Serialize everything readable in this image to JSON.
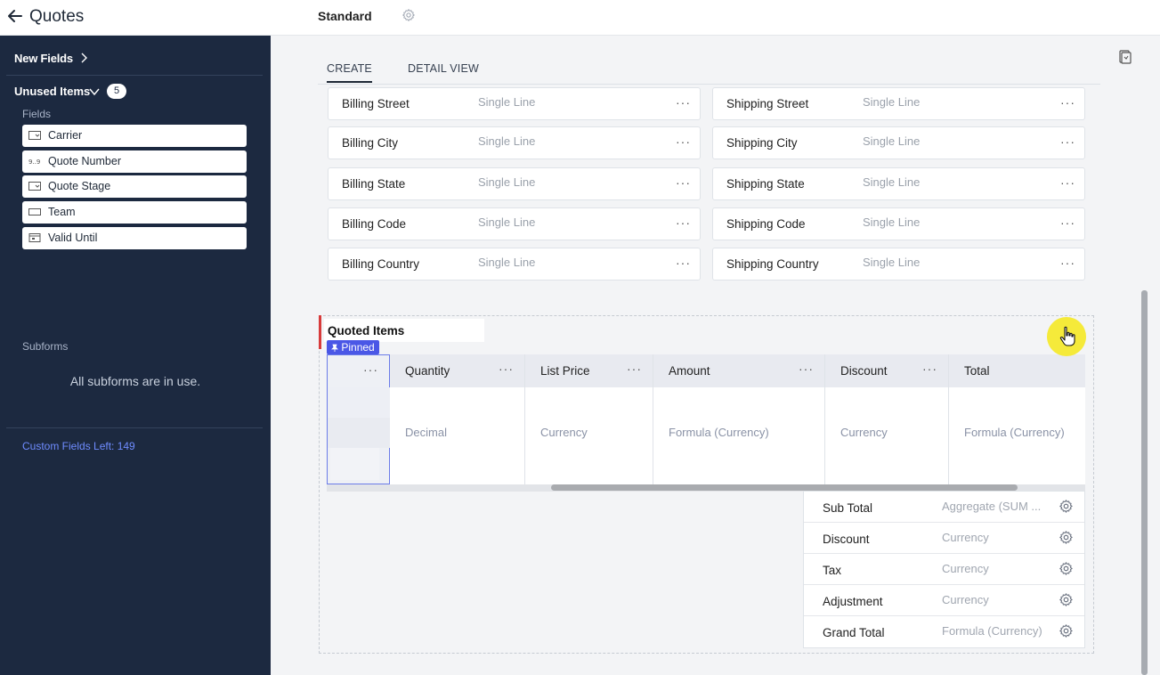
{
  "header": {
    "title": "Quotes",
    "layout_name": "Standard"
  },
  "sidebar": {
    "new_fields_label": "New Fields",
    "unused_items_label": "Unused Items",
    "unused_count": "5",
    "fields_section": "Fields",
    "fields": [
      {
        "label": "Carrier",
        "icon": "picklist-icon"
      },
      {
        "label": "Quote Number",
        "icon": "auto-number-icon"
      },
      {
        "label": "Quote Stage",
        "icon": "picklist-icon"
      },
      {
        "label": "Team",
        "icon": "single-line-icon"
      },
      {
        "label": "Valid Until",
        "icon": "calendar-icon"
      }
    ],
    "subforms_section": "Subforms",
    "subforms_message": "All subforms are in use.",
    "custom_fields_left": "Custom Fields Left: 149"
  },
  "tabs": [
    {
      "label": "CREATE",
      "active": true
    },
    {
      "label": "DETAIL VIEW",
      "active": false
    }
  ],
  "address_fields": [
    {
      "left": {
        "name": "Billing Street",
        "type": "Single Line"
      },
      "right": {
        "name": "Shipping Street",
        "type": "Single Line"
      }
    },
    {
      "left": {
        "name": "Billing City",
        "type": "Single Line"
      },
      "right": {
        "name": "Shipping City",
        "type": "Single Line"
      }
    },
    {
      "left": {
        "name": "Billing State",
        "type": "Single Line"
      },
      "right": {
        "name": "Shipping State",
        "type": "Single Line"
      }
    },
    {
      "left": {
        "name": "Billing Code",
        "type": "Single Line"
      },
      "right": {
        "name": "Shipping Code",
        "type": "Single Line"
      }
    },
    {
      "left": {
        "name": "Billing Country",
        "type": "Single Line"
      },
      "right": {
        "name": "Shipping Country",
        "type": "Single Line"
      }
    }
  ],
  "more_glyph": "···",
  "quoted_items": {
    "title": "Quoted Items",
    "pinned_label": "Pinned",
    "columns": [
      {
        "header": "Quantity",
        "type": "Decimal"
      },
      {
        "header": "List Price",
        "type": "Currency"
      },
      {
        "header": "Amount",
        "type": "Formula (Currency)"
      },
      {
        "header": "Discount",
        "type": "Currency"
      },
      {
        "header": "Total",
        "type": "Formula (Currency)"
      }
    ],
    "aggregates": [
      {
        "name": "Sub Total",
        "type": "Aggregate (SUM ..."
      },
      {
        "name": "Discount",
        "type": "Currency"
      },
      {
        "name": "Tax",
        "type": "Currency"
      },
      {
        "name": "Adjustment",
        "type": "Currency"
      },
      {
        "name": "Grand Total",
        "type": "Formula (Currency)"
      }
    ]
  },
  "colors": {
    "sidebar_bg": "#1c2940",
    "accent": "#4a57e6",
    "section_marker": "#d73b3b",
    "custom_fields_link": "#6f8cff",
    "cursor_highlight": "#f5ea3a"
  }
}
